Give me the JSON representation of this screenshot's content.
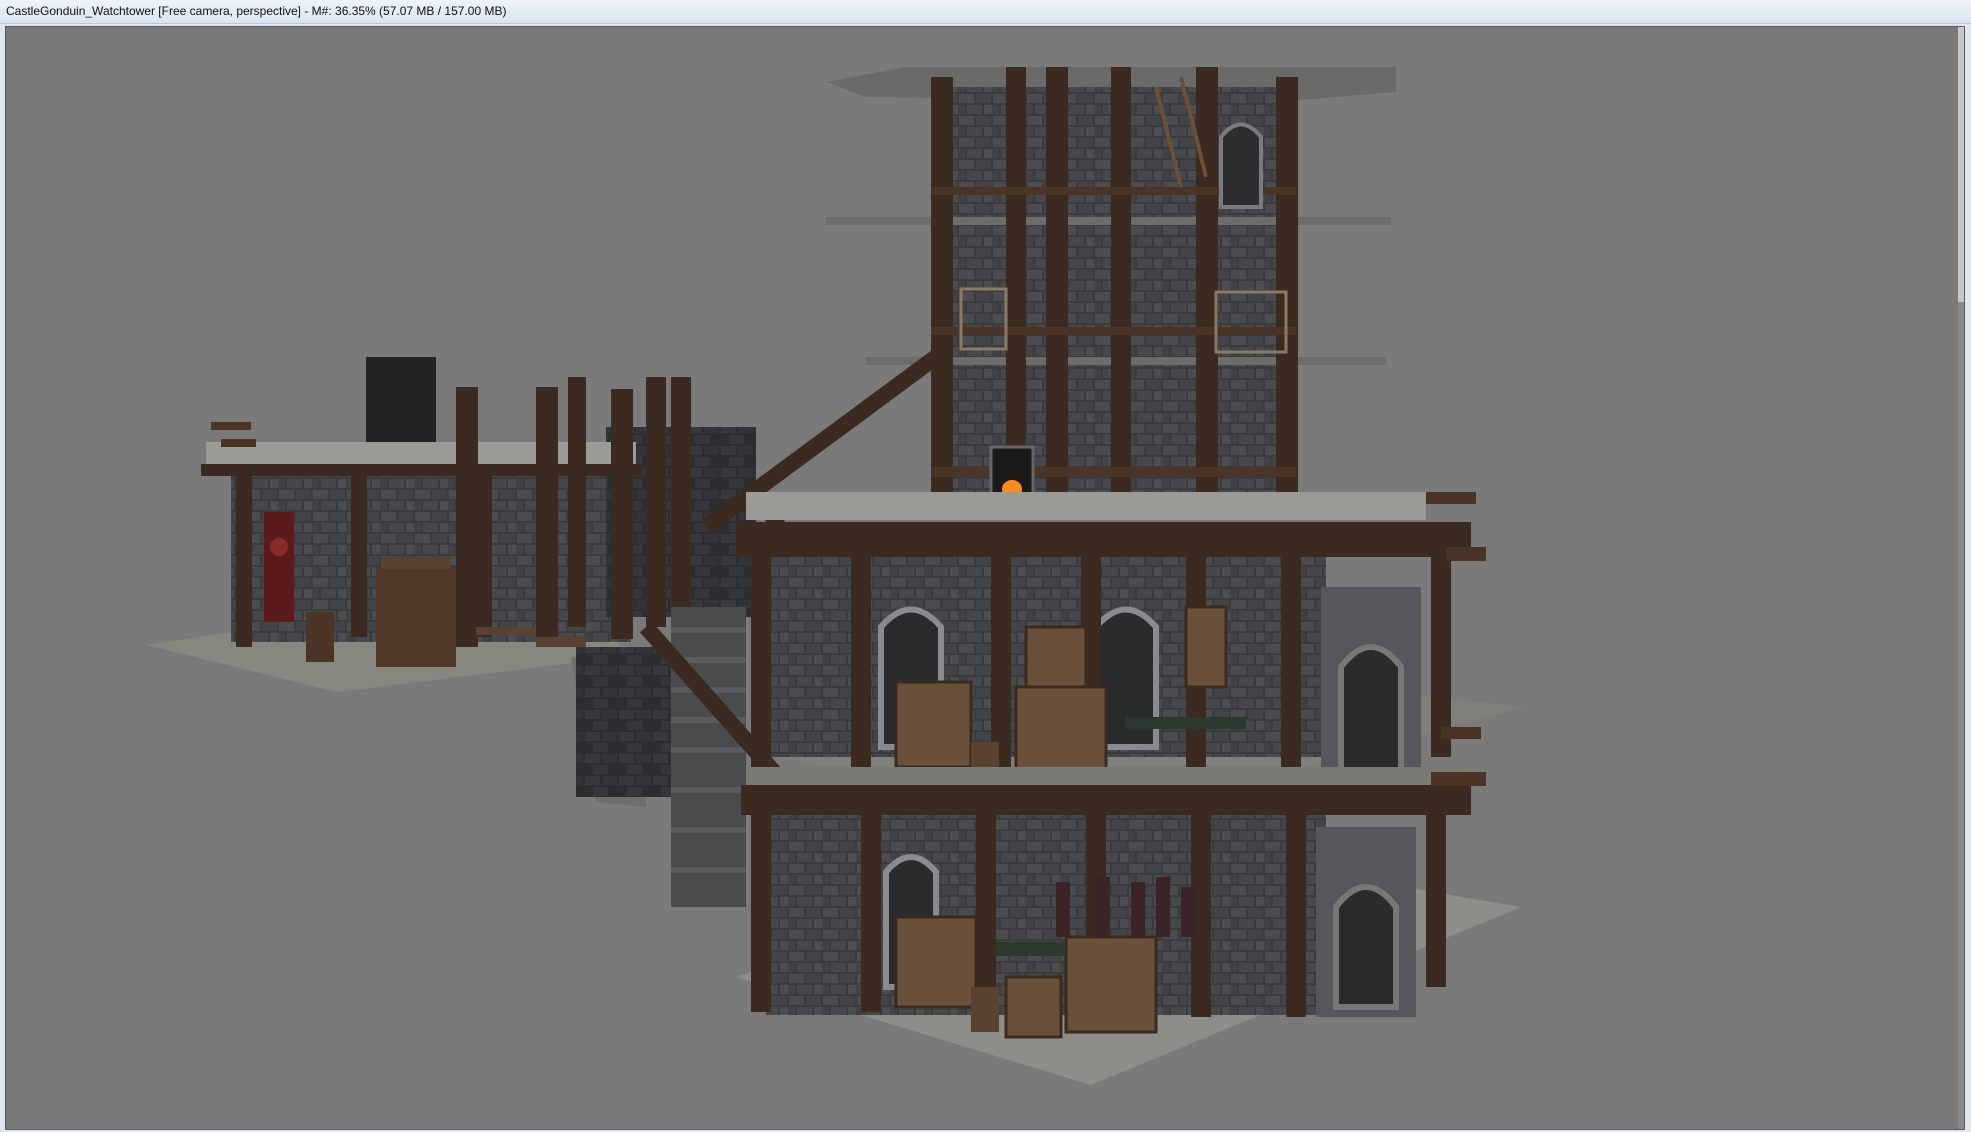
{
  "window": {
    "title": "CastleGonduin_Watchtower [Free camera, perspective] - M#: 36.35% (57.07 MB / 157.00 MB)"
  },
  "viewport": {
    "background": "#7a7a7a"
  },
  "colors": {
    "wood": "#3b2a1f",
    "wood_light": "#5a4230",
    "stone": "#3a3b3d",
    "stone_light": "#55575a",
    "floor": "#8d8e88",
    "fire": "#ff8a1e",
    "banner": "#5b1a1c"
  }
}
